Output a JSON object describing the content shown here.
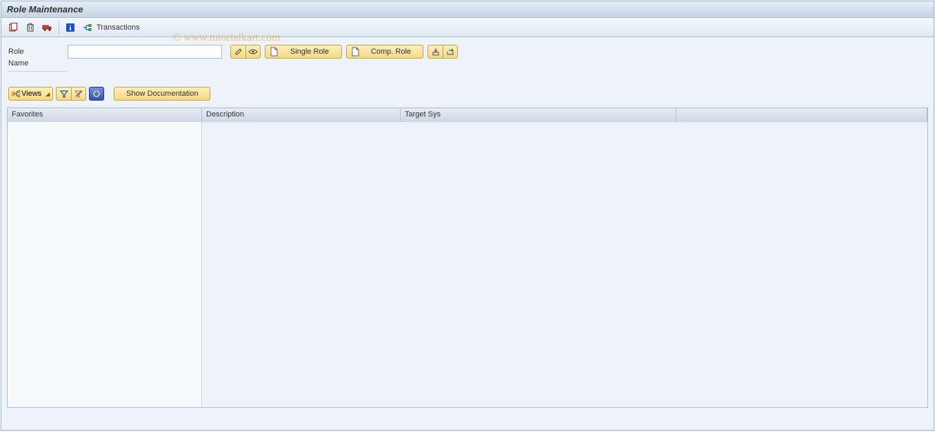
{
  "title": "Role Maintenance",
  "watermark": "© www.tutorialkart.com",
  "toolbar": {
    "transactions_label": "Transactions"
  },
  "fields": {
    "role_label": "Role",
    "role_value": "",
    "name_label": "Name",
    "name_value": ""
  },
  "buttons": {
    "single_role": "Single Role",
    "comp_role": "Comp. Role",
    "views": "Views",
    "show_doc": "Show Documentation"
  },
  "grid": {
    "columns": {
      "favorites": "Favorites",
      "description": "Description",
      "target_sys": "Target Sys"
    }
  }
}
